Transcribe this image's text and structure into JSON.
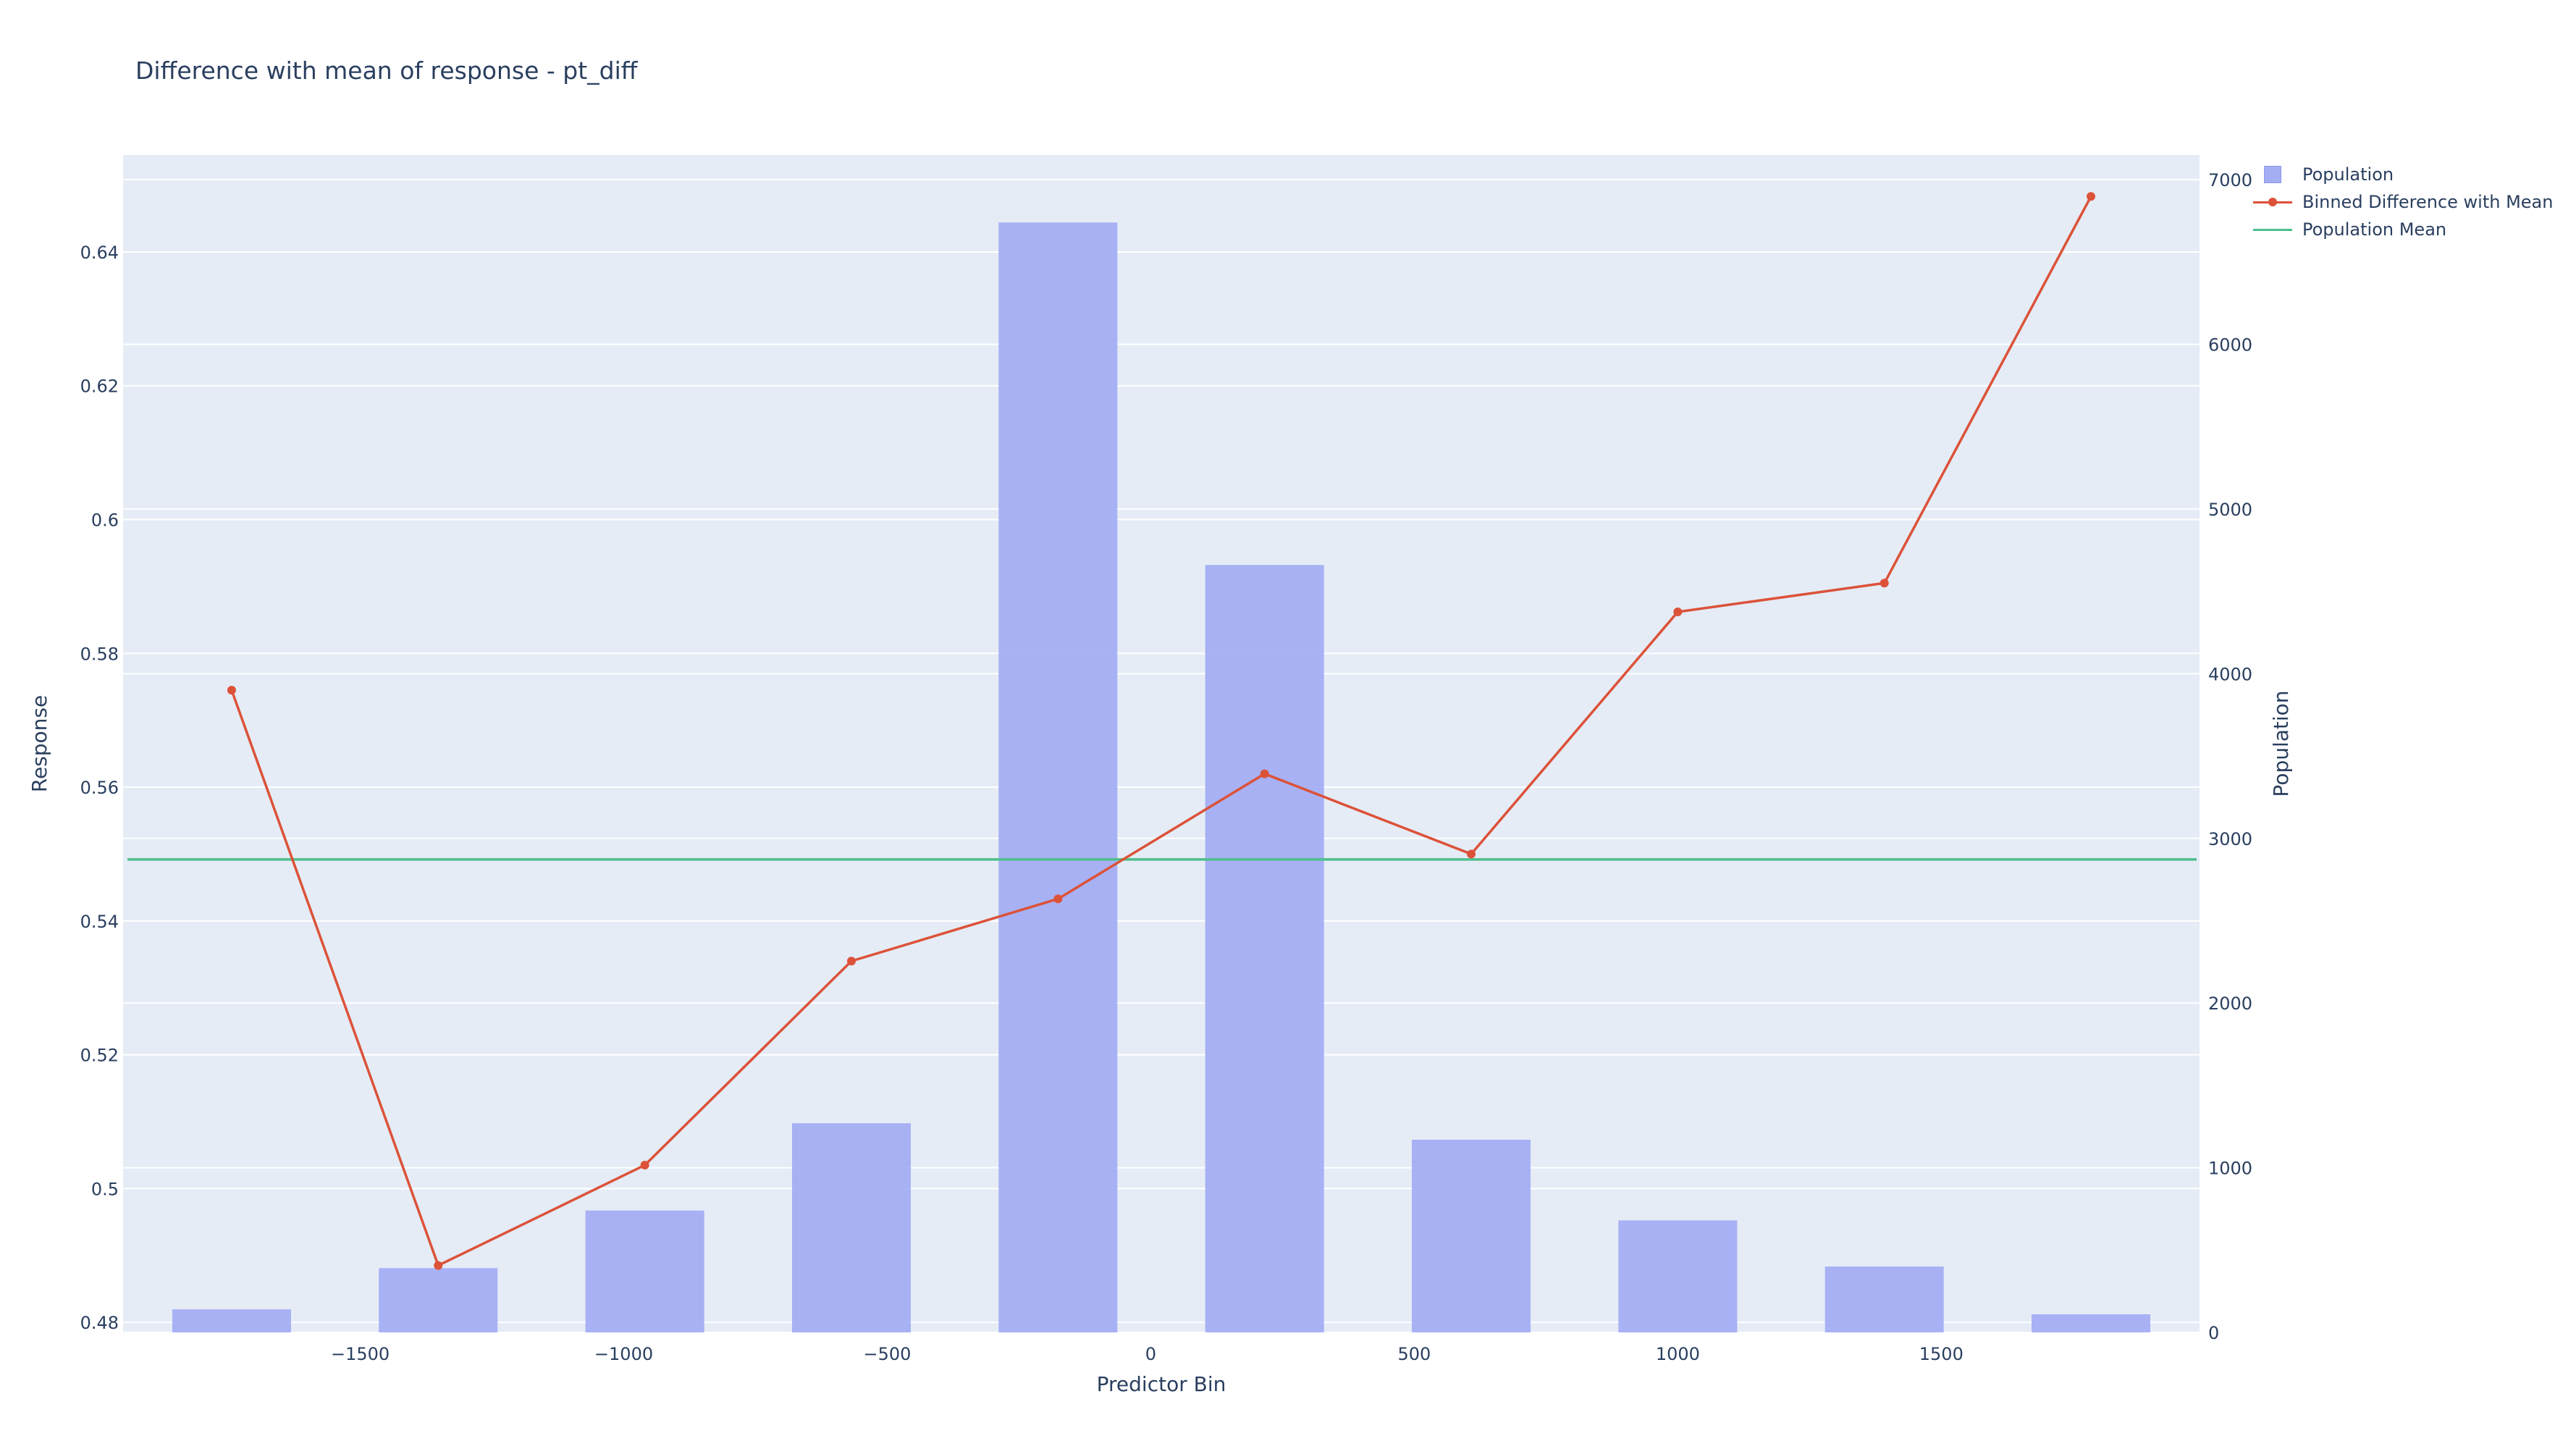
{
  "chart_data": {
    "type": "bar",
    "title": "Difference with mean of response - pt_diff",
    "xlabel": "Predictor Bin",
    "ylabel": "Response",
    "y2label": "Population",
    "x_ticks": [
      -1500,
      -1000,
      -500,
      0,
      500,
      1000,
      1500
    ],
    "x_tick_labels": [
      "−1500",
      "−1000",
      "−500",
      "0",
      "500",
      "1000",
      "1500"
    ],
    "y_ticks": [
      0.48,
      0.5,
      0.52,
      0.54,
      0.56,
      0.58,
      0.6,
      0.62,
      0.64
    ],
    "y_tick_labels": [
      "0.48",
      "0.5",
      "0.52",
      "0.54",
      "0.56",
      "0.58",
      "0.6",
      "0.62",
      "0.64"
    ],
    "y2_ticks": [
      0,
      1000,
      2000,
      3000,
      4000,
      5000,
      6000,
      7000
    ],
    "y2_tick_labels": [
      "0",
      "1000",
      "2000",
      "3000",
      "4000",
      "5000",
      "6000",
      "7000"
    ],
    "xlim": [
      -1950,
      1990
    ],
    "ylim": [
      0.4785,
      0.6545
    ],
    "y2lim": [
      0,
      7150
    ],
    "grid": true,
    "legend_position": "top-right",
    "bin_width": 313,
    "x": [
      -1744,
      -1352,
      -960,
      -568,
      -176,
      216,
      608,
      1000,
      1392,
      1784
    ],
    "series": [
      {
        "name": "Population",
        "type": "bar",
        "axis": "y2",
        "color": "#a4aef3",
        "values": [
          140,
          390,
          740,
          1270,
          6740,
          4660,
          1170,
          680,
          400,
          110
        ]
      },
      {
        "name": "Binned Difference with Mean",
        "type": "line",
        "axis": "y",
        "color": "#dc5239",
        "values": [
          0.5745,
          0.4885,
          0.5035,
          0.534,
          0.5433,
          0.562,
          0.55,
          0.5862,
          0.5905,
          0.6483
        ]
      },
      {
        "name": "Population Mean",
        "type": "hline",
        "axis": "y",
        "color": "#4cc08c",
        "value": 0.5492
      }
    ]
  }
}
